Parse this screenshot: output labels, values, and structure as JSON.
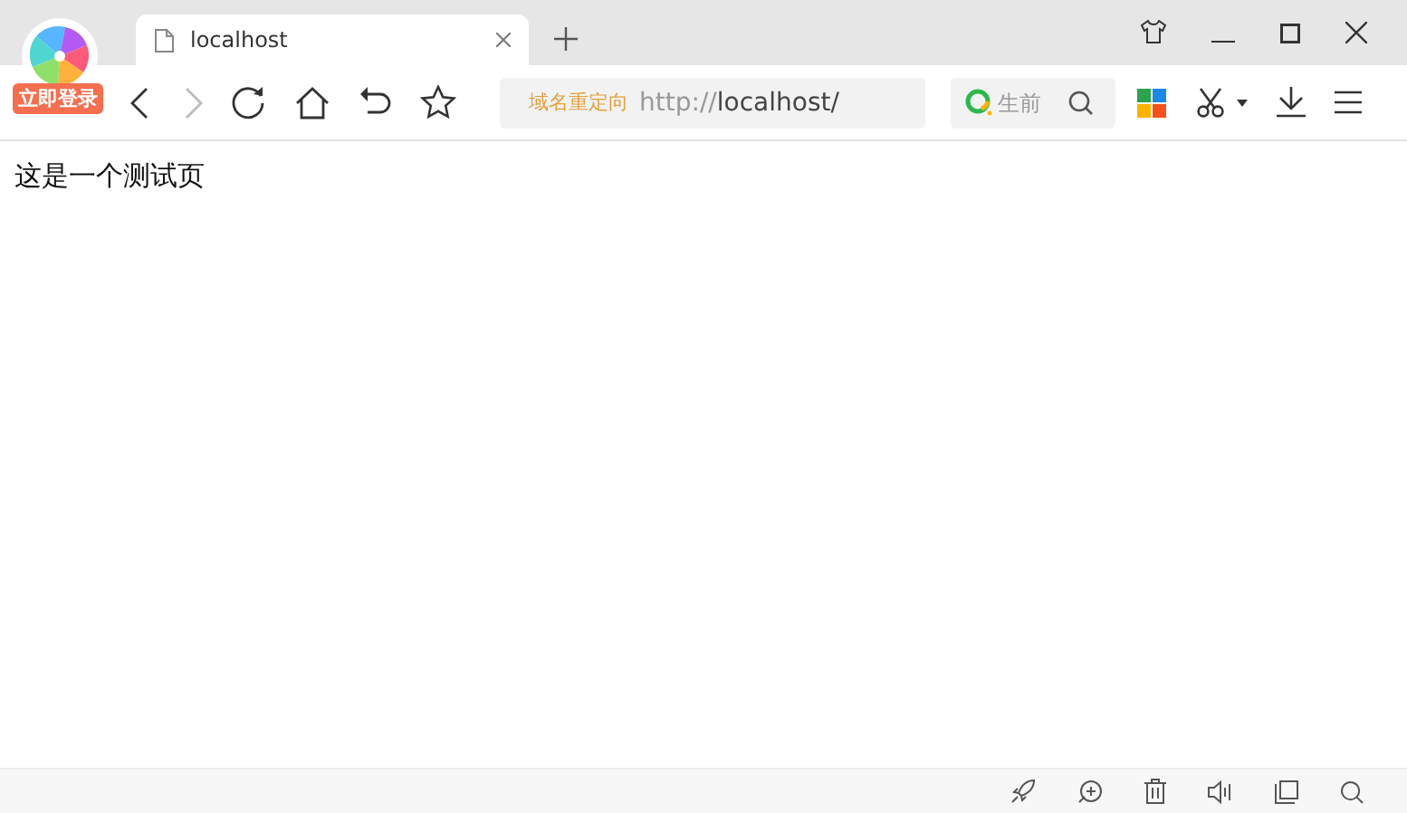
{
  "login_badge": "立即登录",
  "tabs": [
    {
      "title": "localhost",
      "selected": true
    }
  ],
  "address_bar": {
    "redirect_label": "域名重定向",
    "url_scheme": "http://",
    "url_rest": "localhost/"
  },
  "search": {
    "placeholder": "生前"
  },
  "page": {
    "text": "这是一个测试页"
  }
}
